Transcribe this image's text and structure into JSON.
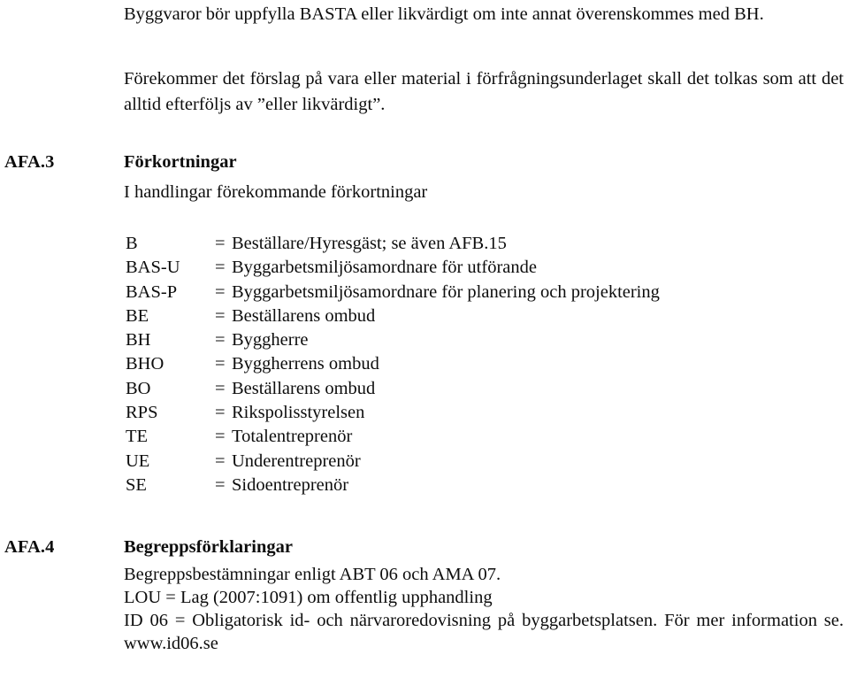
{
  "document": {
    "language": "sv",
    "paragraphs": {
      "intro_1": "Byggvaror bör uppfylla BASTA eller likvärdigt om inte annat överenskommes med BH.",
      "intro_2": "Förekommer det förslag på vara eller material i förfrågningsunderlaget skall det tolkas som att det alltid efterföljs av ”eller likvärdigt”."
    },
    "sections": [
      {
        "code": "AFA.3",
        "heading": "Förkortningar",
        "intro": "I handlingar förekommande förkortningar",
        "abbreviations": [
          {
            "key": "B",
            "eq": "=",
            "value": "Beställare/Hyresgäst; se även AFB.15"
          },
          {
            "key": "BAS-U",
            "eq": "=",
            "value": "Byggarbetsmiljösamordnare för utförande"
          },
          {
            "key": "BAS-P",
            "eq": "=",
            "value": "Byggarbetsmiljösamordnare för planering och projektering"
          },
          {
            "key": "BE",
            "eq": "=",
            "value": "Beställarens ombud"
          },
          {
            "key": "BH",
            "eq": "=",
            "value": "Byggherre"
          },
          {
            "key": "BHO",
            "eq": "=",
            "value": "Byggherrens ombud"
          },
          {
            "key": "BO",
            "eq": "=",
            "value": "Beställarens ombud"
          },
          {
            "key": "RPS",
            "eq": "=",
            "value": "Rikspolisstyrelsen"
          },
          {
            "key": "TE",
            "eq": "=",
            "value": "Totalentreprenör"
          },
          {
            "key": "UE",
            "eq": "=",
            "value": "Underentreprenör"
          },
          {
            "key": "SE",
            "eq": "=",
            "value": "Sidoentreprenör"
          }
        ]
      },
      {
        "code": "AFA.4",
        "heading": "Begreppsförklaringar",
        "lines": [
          "Begreppsbestämningar enligt ABT 06 och AMA 07.",
          "LOU = Lag (2007:1091) om offentlig upphandling",
          "ID 06 = Obligatorisk id- och närvaroredovisning på byggarbetsplatsen. För mer",
          "information se. www.id06.se"
        ],
        "line_3_full": "ID 06 = Obligatorisk id- och närvaroredovisning på byggarbetsplatsen. För mer information se. www.id06.se"
      }
    ]
  },
  "colors": {
    "page_background": "#ffffff",
    "text": "#0d0d0d"
  }
}
